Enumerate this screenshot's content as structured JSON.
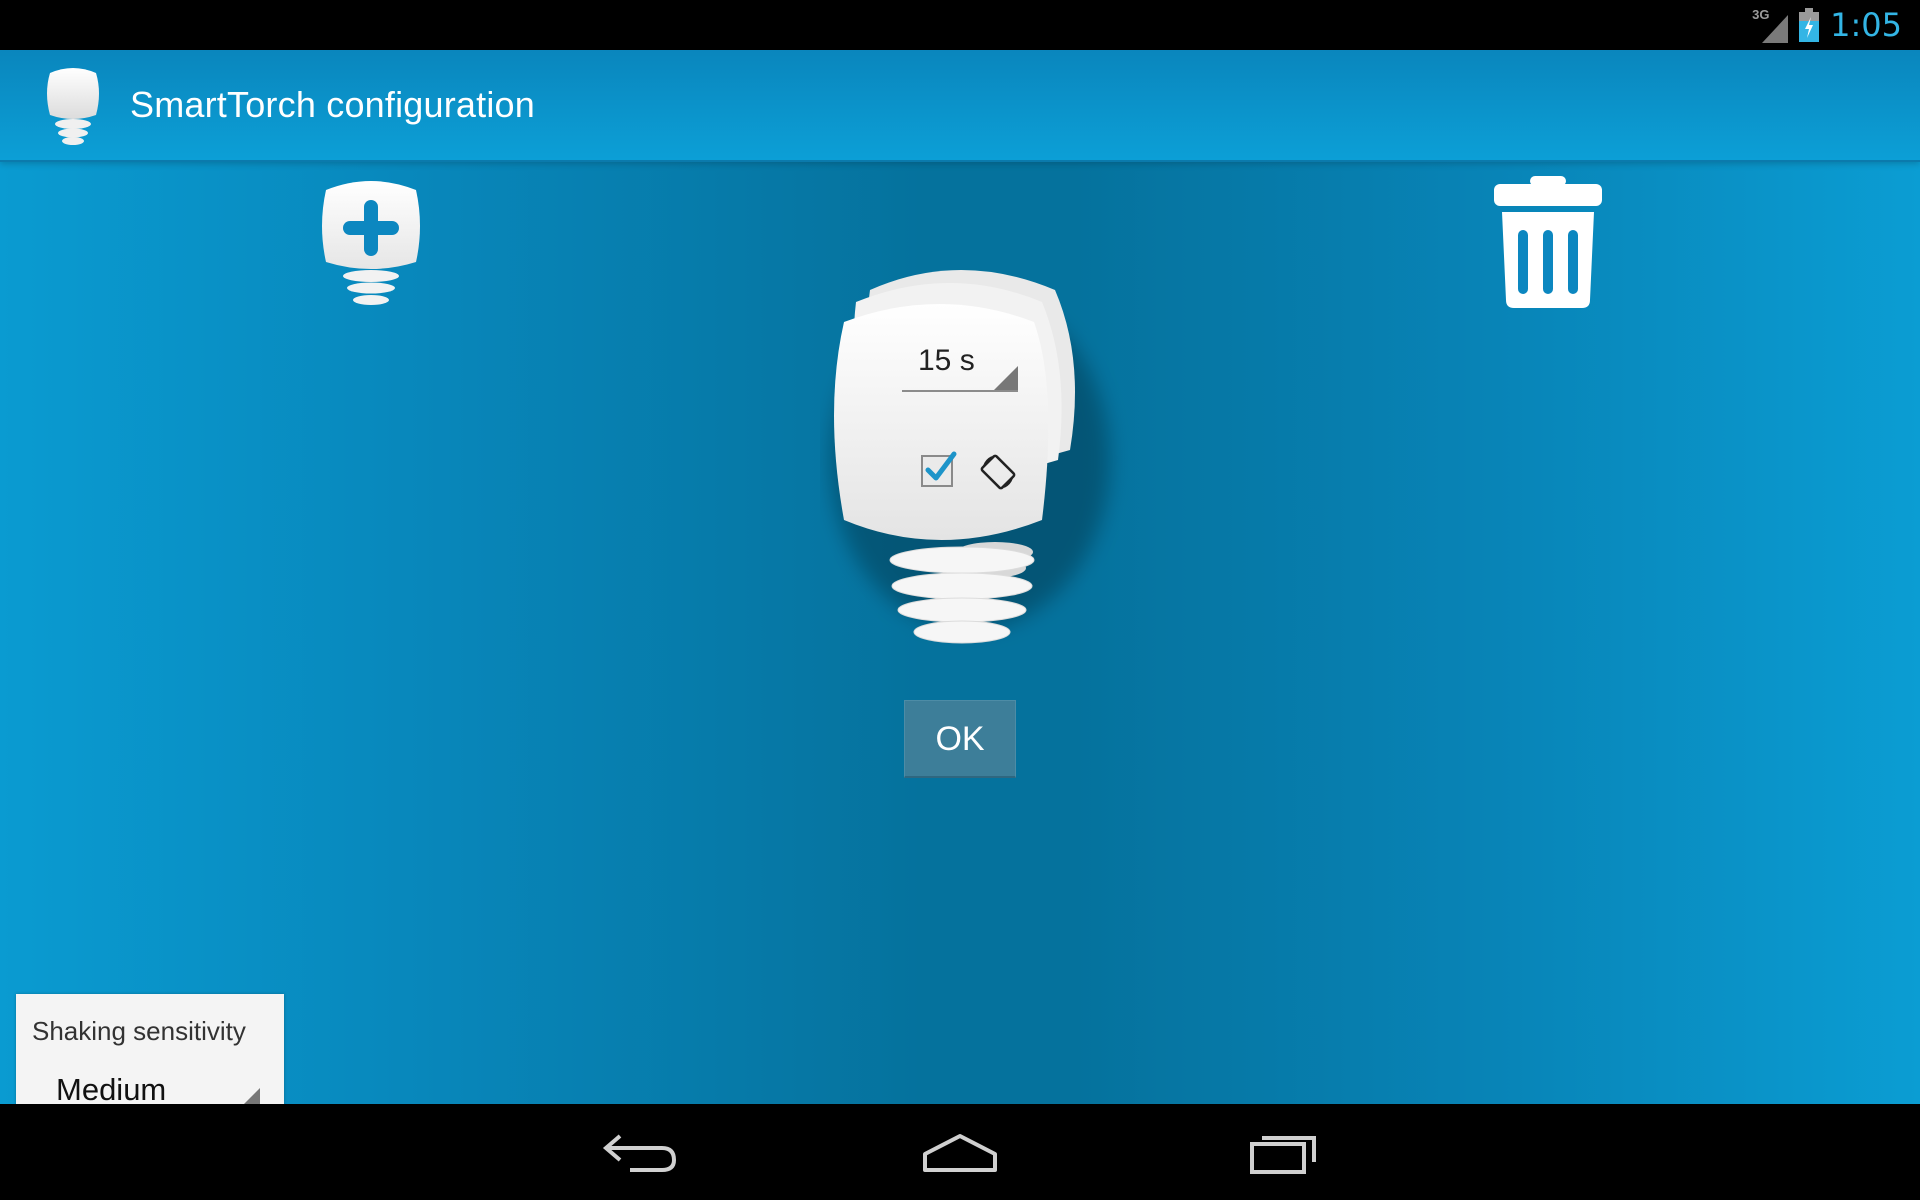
{
  "status_bar": {
    "network_label": "3G",
    "time": "1:05",
    "icons": [
      "signal-icon",
      "battery-charging-icon"
    ]
  },
  "action_bar": {
    "app_icon": "torch-bulb-icon",
    "title": "SmartTorch configuration"
  },
  "toolbar": {
    "add_icon": "add-torch-icon",
    "delete_icon": "trash-icon"
  },
  "torch_config": {
    "timeout_value": "15 s",
    "shake_enabled": true,
    "rotate_icon": "screen-rotation-icon"
  },
  "ok_label": "OK",
  "sensitivity": {
    "label": "Shaking sensitivity",
    "value": "Medium"
  },
  "nav_bar": {
    "buttons": [
      "back-icon",
      "home-icon",
      "recent-apps-icon"
    ]
  },
  "colors": {
    "accent": "#33b5e5",
    "background_light": "#0b9dd3",
    "background_dark": "#05729d",
    "ok_button": "#3d7e99",
    "icon_blue": "#0c87c0"
  }
}
